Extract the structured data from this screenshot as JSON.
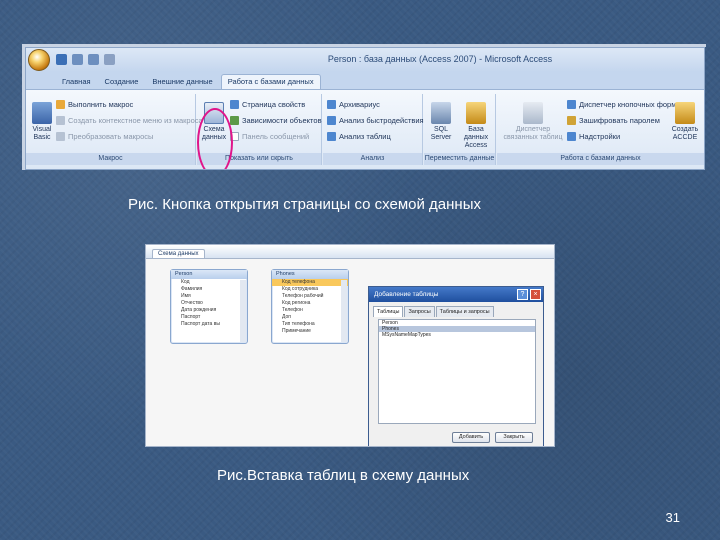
{
  "ribbon": {
    "window_title": "Person : база данных (Access 2007) - Microsoft Access",
    "tabs": [
      "Главная",
      "Создание",
      "Внешние данные",
      "Работа с базами данных"
    ],
    "active_tab_index": 3,
    "groups": {
      "macro": {
        "label": "Макрос",
        "visual_basic_label": "Visual Basic",
        "run_macro": "Выполнить макрос",
        "context_menu_macro": "Создать контекстное меню из макроса",
        "convert_macros": "Преобразовать макросы"
      },
      "show_hide": {
        "label": "Показать или скрыть",
        "schema_label": "Схема данных",
        "properties": "Страница свойств",
        "dependencies": "Зависимости объектов",
        "message_bar": "Панель сообщений"
      },
      "analyze": {
        "label": "Анализ",
        "documenter": "Архивариус",
        "performance": "Анализ быстродействия",
        "table_analyze": "Анализ таблиц"
      },
      "move_data": {
        "label": "Переместить данные",
        "sql_server": "SQL Server",
        "access_db": "База данных Access"
      },
      "db_tools": {
        "label": "Работа с базами данных",
        "linked_table_manager": "Диспетчер связанных таблиц",
        "switchboard": "Диспетчер кнопочных форм",
        "encrypt": "Зашифровать паролем",
        "addins": "Надстройки",
        "make_accde": "Создать ACCDE"
      }
    }
  },
  "caption_top": "Рис. Кнопка открытия страницы со схемой данных",
  "schema": {
    "tab_label": "Схема данных",
    "table1": {
      "title": "Person",
      "fields": [
        "Код",
        "Фамилия",
        "Имя",
        "Отчество",
        "Дата рождения",
        "Паспорт",
        "Паспорт дата вы"
      ]
    },
    "table2": {
      "title": "Phones",
      "fields": [
        "Код телефона",
        "Код сотрудника",
        "Телефон рабочий",
        "Код региона",
        "Телефон",
        "Доп",
        "Тип телефона",
        "Примечание"
      ]
    },
    "dialog": {
      "title": "Добавление таблицы",
      "help": "?",
      "close": "×",
      "tabs": [
        "Таблицы",
        "Запросы",
        "Таблицы и запросы"
      ],
      "items": [
        "Person",
        "Phones",
        "MSysNameMapTypes"
      ],
      "selected_index": 1,
      "add_button": "Добавить",
      "close_button": "Закрыть"
    }
  },
  "caption_bottom": "Рис.Вставка таблиц в схему данных",
  "page_number": "31",
  "colors": {
    "background": "#3a5a82",
    "highlight_ring": "#e0158a",
    "selected_field": "#f9c85c"
  }
}
